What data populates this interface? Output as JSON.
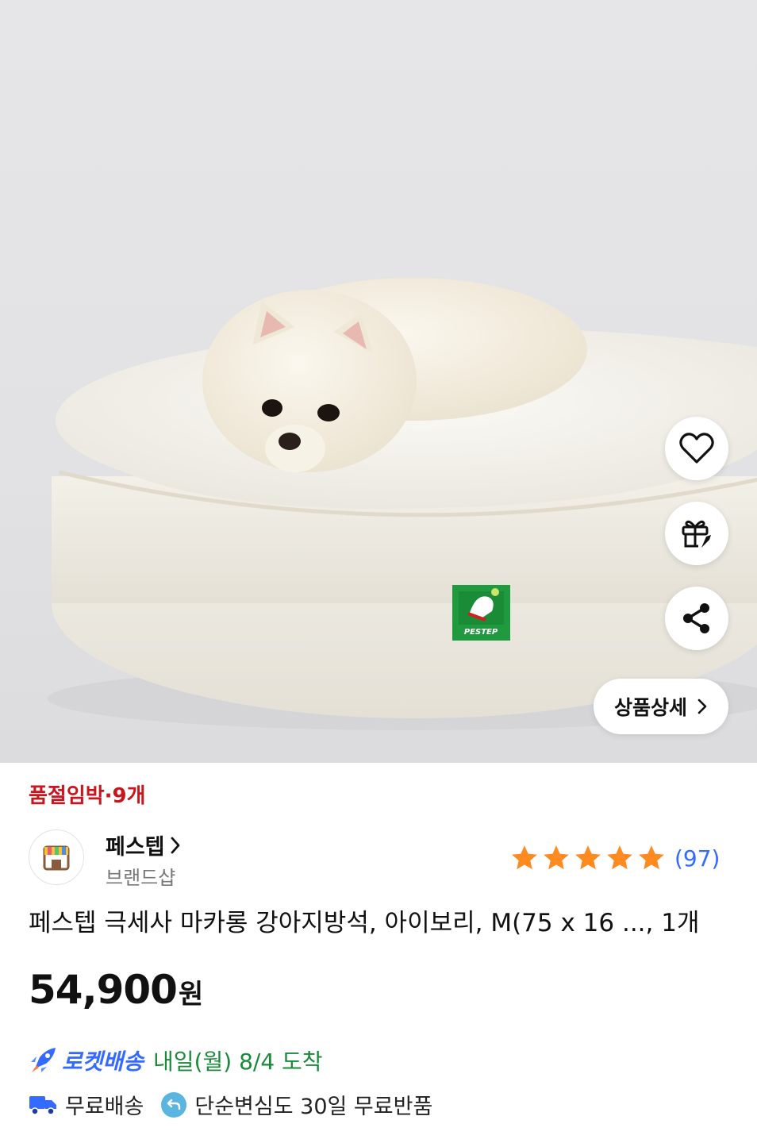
{
  "product_image": {
    "badge_text": "PESTEP"
  },
  "actions": {
    "detail_label": "상품상세"
  },
  "stock": {
    "text": "품절임박·9개"
  },
  "seller": {
    "name": "페스텝",
    "sub": "브랜드샵"
  },
  "rating": {
    "stars": 5,
    "count": "(97)",
    "star_color": "#ff8a1f"
  },
  "product": {
    "title": "페스텝 극세사 마카롱 강아지방석, 아이보리, M(75 x 16 ..., 1개"
  },
  "price": {
    "amount": "54,900",
    "unit": "원"
  },
  "delivery": {
    "label": "로켓배송",
    "arrival": "내일(월) 8/4 도착",
    "label_color": "#346aff",
    "arrival_color": "#1a8a3a"
  },
  "benefits": {
    "free_shipping": "무료배송",
    "free_return": "단순변심도 30일 무료반품"
  },
  "colors": {
    "stock_red": "#c8161d",
    "accent_blue": "#346aff"
  }
}
